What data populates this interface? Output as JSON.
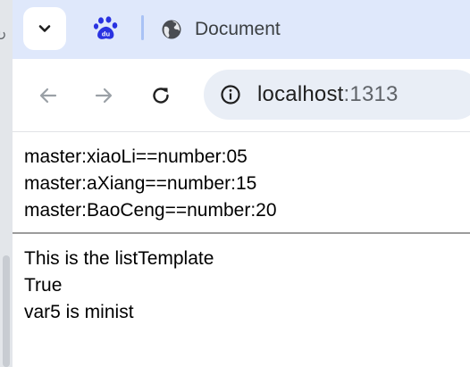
{
  "tabstrip": {
    "search_tabs_icon": "chevron-down-icon",
    "tabs": [
      {
        "icon": "baidu-paw-icon",
        "label": ""
      },
      {
        "icon": "globe-icon",
        "label": "Document"
      }
    ],
    "colors": {
      "background": "#dfe8fb",
      "separator": "#a9c2f5",
      "baidu_blue": "#2932e1"
    }
  },
  "toolbar": {
    "back_icon": "arrow-left-icon",
    "forward_icon": "arrow-right-icon",
    "reload_icon": "reload-icon",
    "site_info_icon": "info-icon",
    "url_host": "localhost",
    "url_port": ":1313",
    "colors": {
      "omnibox": "#e9eef6"
    }
  },
  "page": {
    "masters": [
      "master:xiaoLi==number:05",
      "master:aXiang==number:15",
      "master:BaoCeng==number:20"
    ],
    "lines": [
      "This is the listTemplate",
      "True",
      "var5 is minist"
    ]
  }
}
